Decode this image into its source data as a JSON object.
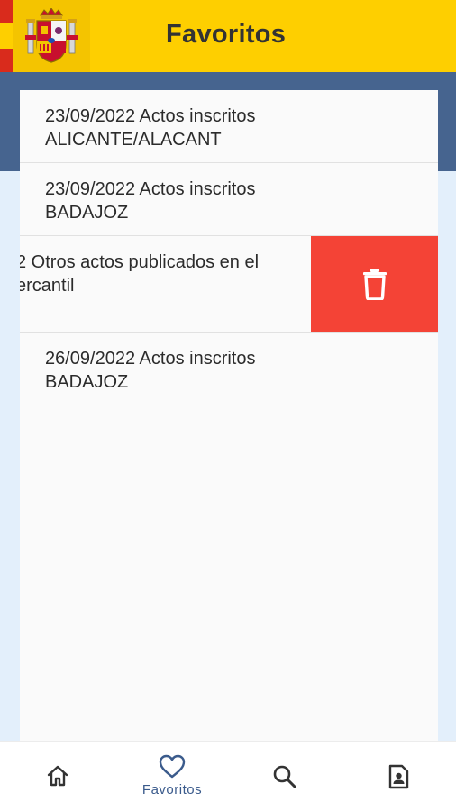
{
  "header": {
    "title": "Favoritos",
    "logo_icon": "coat-of-arms-icon"
  },
  "colors": {
    "header": "#fecf00",
    "band": "#46648f",
    "delete": "#f44336",
    "nav_active": "#3b5b8c"
  },
  "favorites": [
    {
      "line1": "23/09/2022 Actos inscritos",
      "line2": "ALICANTE/ALACANT"
    },
    {
      "line1": "23/09/2022 Actos inscritos",
      "line2": "BADAJOZ"
    },
    {
      "line1": "2 Otros actos publicados en el",
      "line2": "ercantil"
    },
    {
      "line1": "26/09/2022 Actos inscritos",
      "line2": "BADAJOZ"
    }
  ],
  "swipe_action": {
    "icon": "trash-icon"
  },
  "bottom_nav": [
    {
      "icon": "home-icon",
      "label": ""
    },
    {
      "icon": "heart-icon",
      "label": "Favoritos",
      "active": true
    },
    {
      "icon": "search-icon",
      "label": ""
    },
    {
      "icon": "contact-icon",
      "label": ""
    }
  ]
}
